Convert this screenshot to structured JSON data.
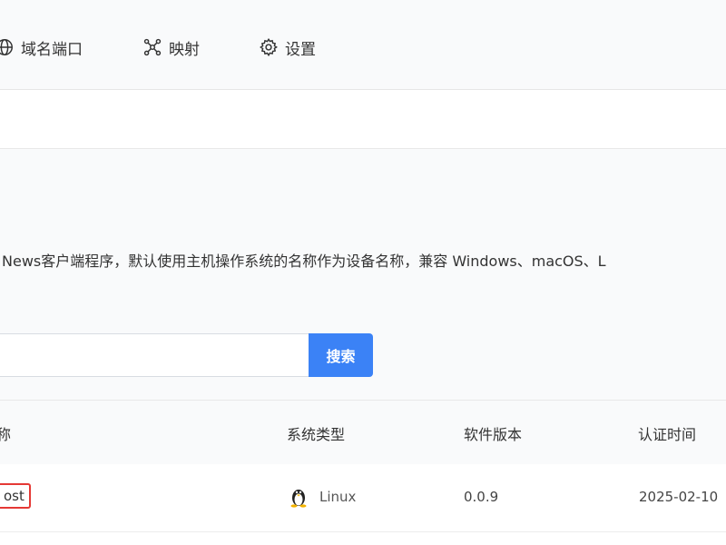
{
  "nav": {
    "items": [
      {
        "label": "域名端口",
        "icon": "globe-icon"
      },
      {
        "label": "映射",
        "icon": "network-icon"
      },
      {
        "label": "设置",
        "icon": "gear-icon"
      }
    ]
  },
  "main": {
    "description": "News客户端程序，默认使用主机操作系统的名称作为设备名称，兼容 Windows、macOS、L",
    "search": {
      "value": "",
      "placeholder": "",
      "button_label": "搜索"
    }
  },
  "table": {
    "columns": [
      "称",
      "系统类型",
      "软件版本",
      "认证时间"
    ],
    "rows": [
      {
        "name": "ost",
        "os": "Linux",
        "os_icon": "linux-penguin-icon",
        "version": "0.0.9",
        "auth_time": "2025-02-10"
      }
    ]
  },
  "colors": {
    "accent": "#3b82f6",
    "highlight": "#e53935"
  }
}
